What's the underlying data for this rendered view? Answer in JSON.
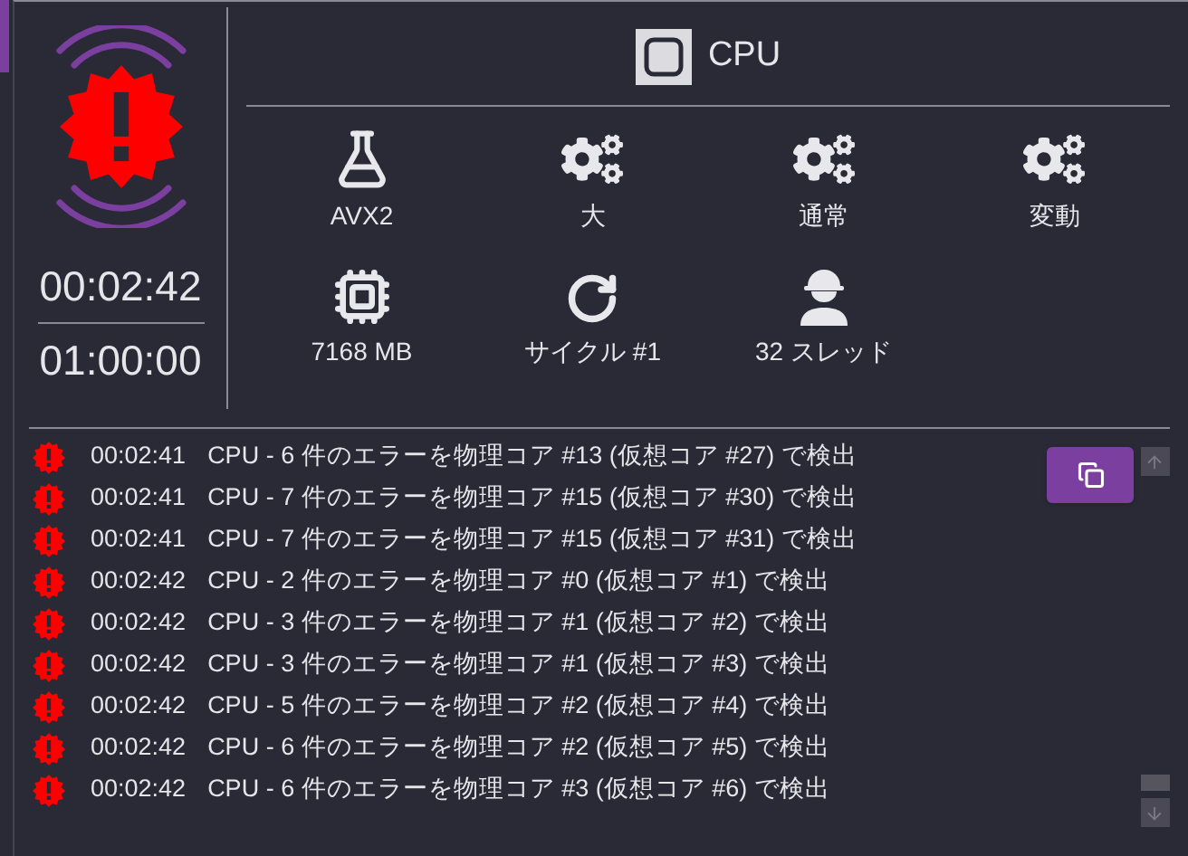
{
  "timer": {
    "elapsed": "00:02:42",
    "limit": "01:00:00"
  },
  "header": {
    "title": "CPU"
  },
  "stats": [
    {
      "kind": "flask",
      "label": "AVX2"
    },
    {
      "kind": "gears",
      "label": "大"
    },
    {
      "kind": "gears",
      "label": "通常"
    },
    {
      "kind": "gears",
      "label": "変動"
    },
    {
      "kind": "chip",
      "label": "7168 MB"
    },
    {
      "kind": "cycle",
      "label": "サイクル #1"
    },
    {
      "kind": "worker",
      "label": "32 スレッド"
    }
  ],
  "log": [
    {
      "time": "00:02:41",
      "message": "CPU - 6 件のエラーを物理コア #13 (仮想コア #27) で検出"
    },
    {
      "time": "00:02:41",
      "message": "CPU - 7 件のエラーを物理コア #15 (仮想コア #30) で検出"
    },
    {
      "time": "00:02:41",
      "message": "CPU - 7 件のエラーを物理コア #15 (仮想コア #31) で検出"
    },
    {
      "time": "00:02:42",
      "message": "CPU - 2 件のエラーを物理コア #0 (仮想コア #1) で検出"
    },
    {
      "time": "00:02:42",
      "message": "CPU - 3 件のエラーを物理コア #1 (仮想コア #2) で検出"
    },
    {
      "time": "00:02:42",
      "message": "CPU - 3 件のエラーを物理コア #1 (仮想コア #3) で検出"
    },
    {
      "time": "00:02:42",
      "message": "CPU - 5 件のエラーを物理コア #2 (仮想コア #4) で検出"
    },
    {
      "time": "00:02:42",
      "message": "CPU - 6 件のエラーを物理コア #2 (仮想コア #5) で検出"
    },
    {
      "time": "00:02:42",
      "message": "CPU - 6 件のエラーを物理コア #3 (仮想コア #6) で検出"
    }
  ]
}
